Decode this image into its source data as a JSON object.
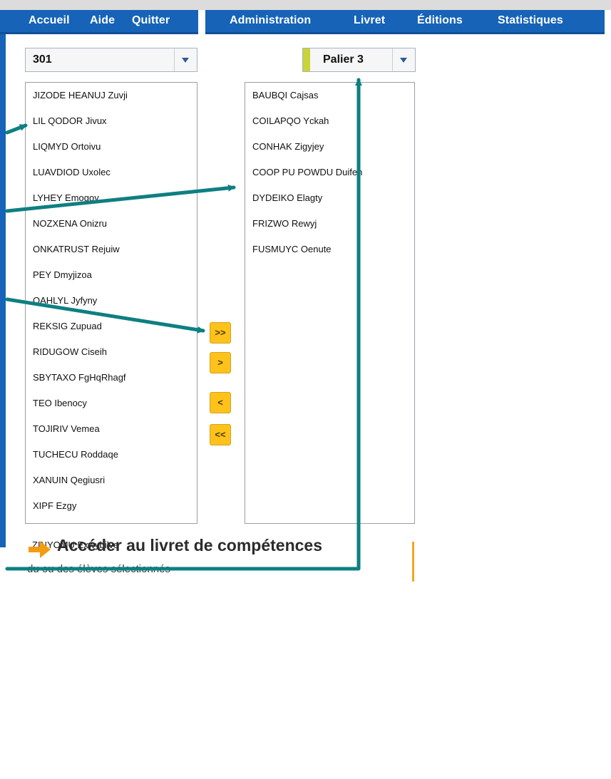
{
  "nav": {
    "left": [
      "Accueil",
      "Aide",
      "Quitter"
    ],
    "right": [
      "Administration",
      "Livret",
      "Éditions",
      "Statistiques"
    ]
  },
  "class_select": {
    "value": "301"
  },
  "palier_select": {
    "value": "Palier 3"
  },
  "left_list": [
    "JIZODE HEANUJ Zuvji",
    "LIL QODOR Jivux",
    "LIQMYD Ortoivu",
    "LUAVDIOD Uxolec",
    "LYHEY Emogoy",
    "NOZXENA Onizru",
    "ONKATRUST Rejuiw",
    "PEY Dmyjizoa",
    "QAHLYL Jyfyny",
    "REKSIG Zupuad",
    "RIDUGOW Ciseih",
    "SBYTAXO FgHqRhagf",
    "TEO Ibenocy",
    "TOJIRIV Vemea",
    "TUCHECU Roddaqe",
    "XANUIN Qegiusri",
    "XIPF Ezgy",
    "ZINYOMU Exwybilve"
  ],
  "right_list": [
    "BAUBQI Cajsas",
    "COILAPQO Yckah",
    "CONHAK Zigyjey",
    "COOP PU POWDU Duifeh",
    "DYDEIKO Elagty",
    "FRIZWO Rewyj",
    "FUSMUYC Oenute"
  ],
  "buttons": {
    "move_all_right": ">>",
    "move_right": ">",
    "move_left": "<",
    "move_all_left": "<<"
  },
  "cta": {
    "title": "Accéder au livret de compétences",
    "subtitle": "du ou des élèves sélectionnés"
  },
  "colors": {
    "nav_blue": "#1663b8",
    "button_orange": "#ffc21a",
    "annotation_teal": "#0e7f82",
    "cta_arrow": "#f39c12"
  },
  "icons": {
    "dropdown": "triangle-down",
    "cta": "arrow-right"
  }
}
